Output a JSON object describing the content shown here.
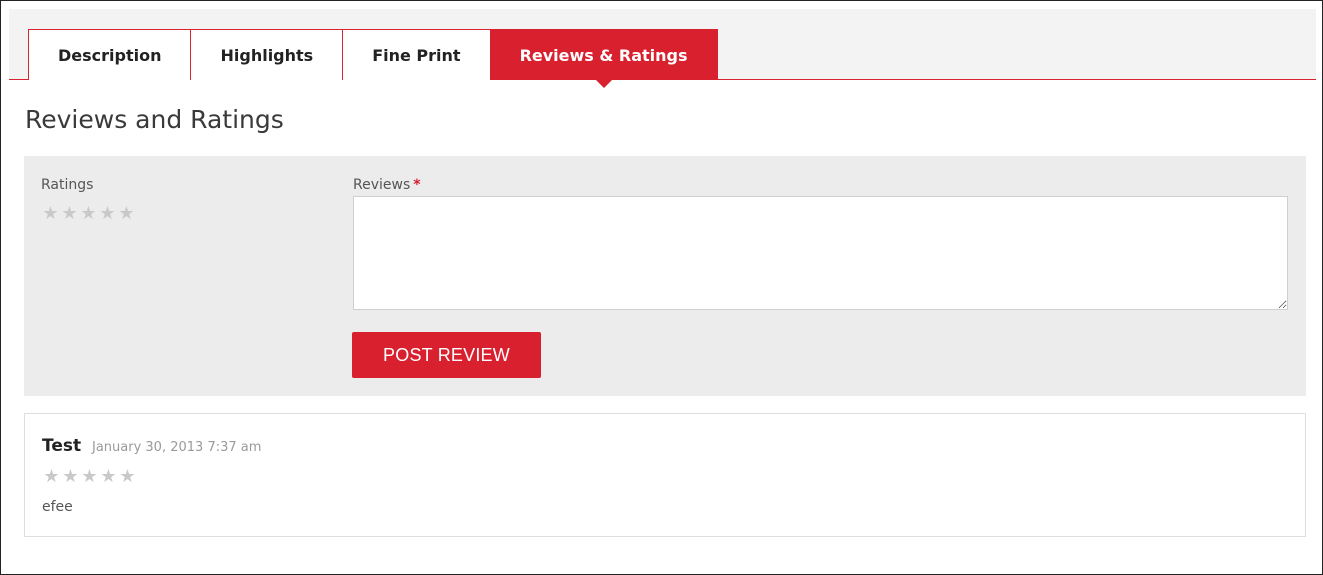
{
  "tabs": [
    {
      "label": "Description",
      "active": false
    },
    {
      "label": "Highlights",
      "active": false
    },
    {
      "label": "Fine Print",
      "active": false
    },
    {
      "label": "Reviews & Ratings",
      "active": true
    }
  ],
  "page_title": "Reviews and Ratings",
  "form": {
    "ratings_label": "Ratings",
    "reviews_label": "Reviews",
    "required_mark": "*",
    "review_value": "",
    "submit_label": "POST REVIEW",
    "rating_value": 0,
    "rating_max": 5
  },
  "reviews": [
    {
      "author": "Test",
      "date": "January 30, 2013 7:37 am",
      "rating": 0,
      "rating_max": 5,
      "text": "efee"
    }
  ],
  "colors": {
    "accent": "#d8202f",
    "panel_bg": "#ececec",
    "star_empty": "#c9c9c9"
  },
  "icons": {
    "star": "star-icon"
  }
}
